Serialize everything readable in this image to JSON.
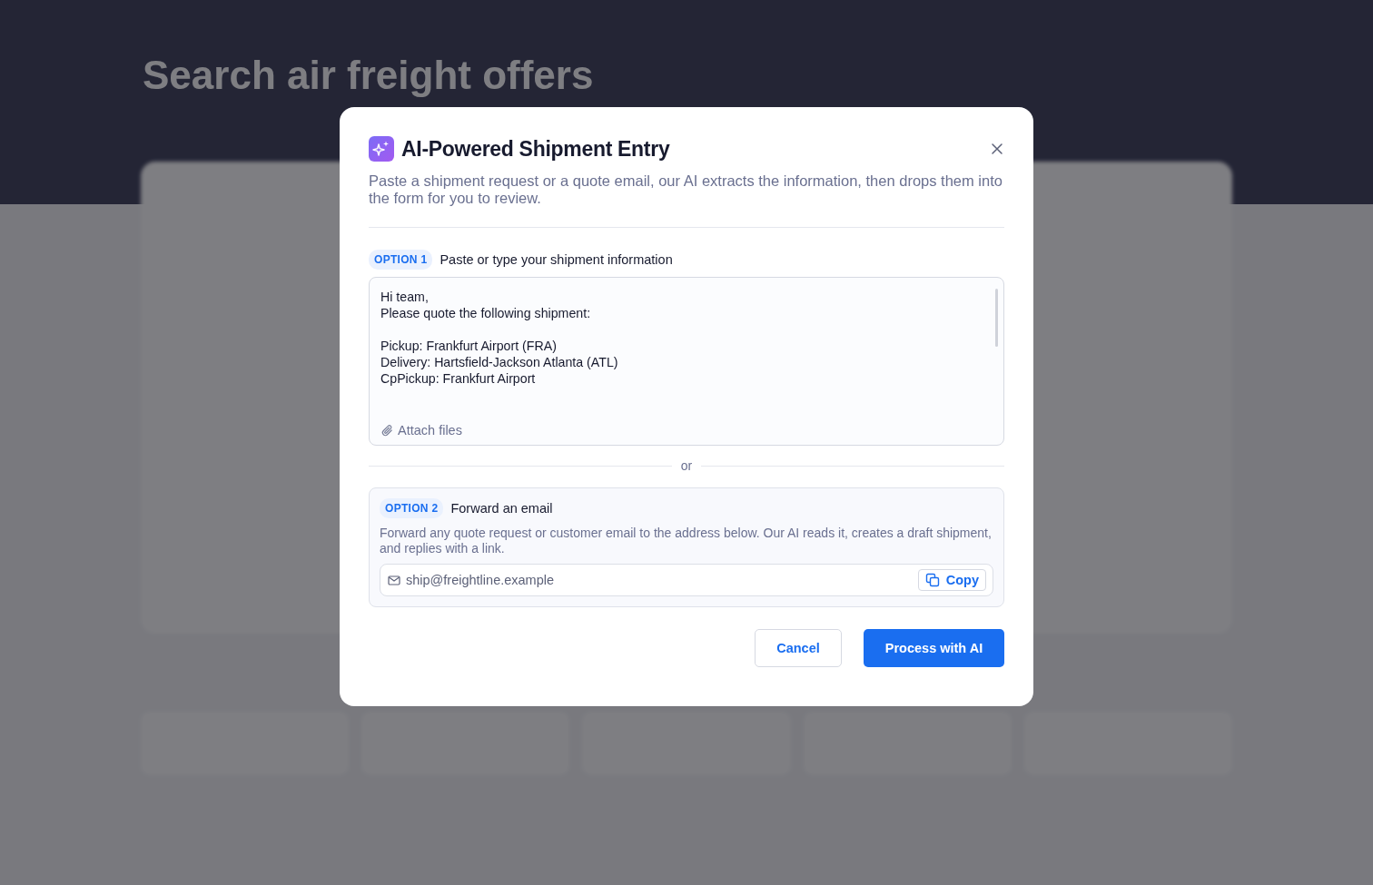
{
  "page": {
    "title": "Search air freight offers"
  },
  "modal": {
    "title": "AI-Powered Shipment Entry",
    "description": "Paste a shipment request or a quote email, our AI extracts the information, then drops them into the form for you to review.",
    "option_1": {
      "badge": "OPTION 1",
      "label": "Paste or type your shipment information",
      "value": "Hi team,\nPlease quote the following shipment:\n\nPickup: Frankfurt Airport (FRA)\nDelivery: Hartsfield-Jackson Atlanta (ATL)\nCpPickup: Frankfurt Airport",
      "attach": "Attach files"
    },
    "divider": "or",
    "option_2": {
      "badge": "OPTION 2",
      "label": "Forward an email",
      "description": "Forward any quote request or customer email to the address below. Our AI reads it, creates a draft shipment, and replies with a link.",
      "email": "ship@freightline.example",
      "copy": "Copy"
    },
    "buttons": {
      "cancel": "Cancel",
      "primary": "Process with AI"
    }
  }
}
